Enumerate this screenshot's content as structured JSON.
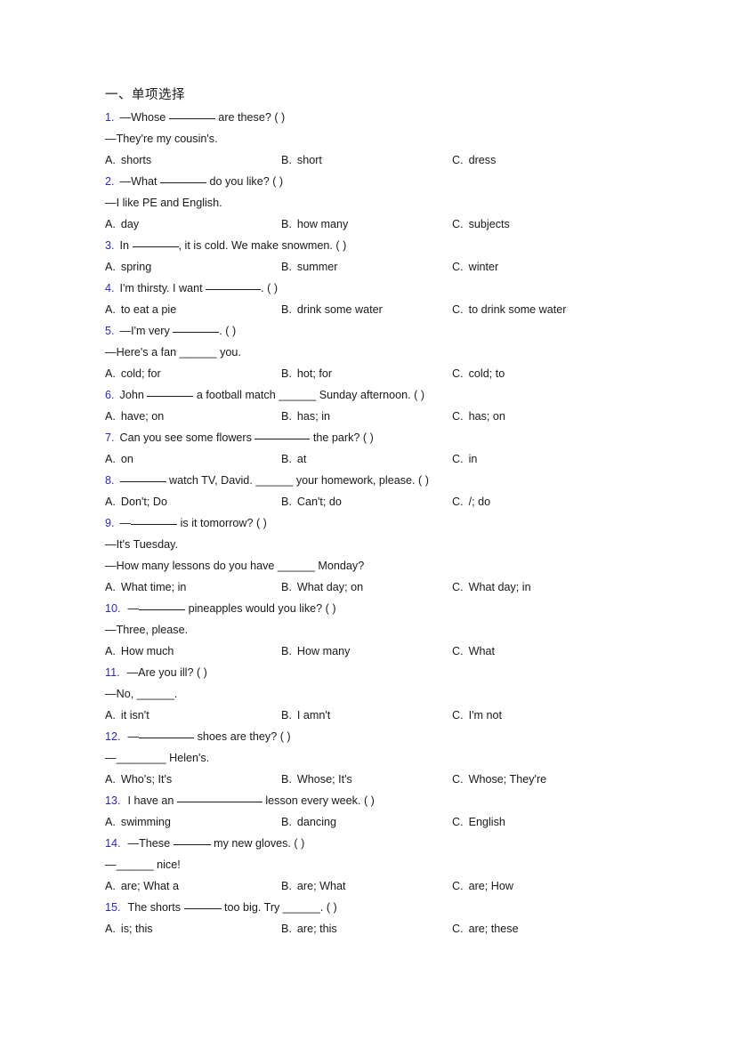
{
  "document": {
    "section_heading": "一、单项选择",
    "blank_marker": "______",
    "answer_paren": "(  )",
    "dash": "—",
    "questions": [
      {
        "number": "1.",
        "prompt_pre": "—Whose ",
        "prompt_post": " are these? (  )",
        "extra_lines": [
          "—They're my cousin's."
        ],
        "options": [
          {
            "letter": "A.",
            "text": "shorts"
          },
          {
            "letter": "B.",
            "text": "short"
          },
          {
            "letter": "C.",
            "text": "dress"
          }
        ]
      },
      {
        "number": "2.",
        "prompt_pre": "—What ",
        "prompt_post": " do you like? (  )",
        "extra_lines": [
          "—I like PE and English."
        ],
        "options": [
          {
            "letter": "A.",
            "text": "day"
          },
          {
            "letter": "B.",
            "text": "how many"
          },
          {
            "letter": "C.",
            "text": "subjects"
          }
        ]
      },
      {
        "number": "3.",
        "prompt_pre": "In ",
        "prompt_post": ", it is cold. We make snowmen. (  )",
        "extra_lines": [],
        "options": [
          {
            "letter": "A.",
            "text": "spring"
          },
          {
            "letter": "B.",
            "text": "summer"
          },
          {
            "letter": "C.",
            "text": "winter"
          }
        ]
      },
      {
        "number": "4.",
        "prompt_pre": "I'm thirsty. I want ",
        "prompt_post": ". (  )",
        "extra_lines": [],
        "options": [
          {
            "letter": "A.",
            "text": "to eat a pie"
          },
          {
            "letter": "B.",
            "text": "drink some water"
          },
          {
            "letter": "C.",
            "text": "to drink some water"
          }
        ]
      },
      {
        "number": "5.",
        "prompt_pre": "—I'm very ",
        "prompt_post": ". (  )",
        "extra_lines": [
          "—Here's a fan ______ you."
        ],
        "options": [
          {
            "letter": "A.",
            "text": "cold; for"
          },
          {
            "letter": "B.",
            "text": "hot; for"
          },
          {
            "letter": "C.",
            "text": "cold; to"
          }
        ]
      },
      {
        "number": "6.",
        "prompt_pre": "John ",
        "prompt_post": " a football match ______ Sunday afternoon. (  )",
        "extra_lines": [],
        "options": [
          {
            "letter": "A.",
            "text": "have; on"
          },
          {
            "letter": "B.",
            "text": "has; in"
          },
          {
            "letter": "C.",
            "text": "has; on"
          }
        ]
      },
      {
        "number": "7.",
        "prompt_pre": "Can you see some flowers ",
        "prompt_post": " the park? (  )",
        "extra_lines": [],
        "options": [
          {
            "letter": "A.",
            "text": "on"
          },
          {
            "letter": "B.",
            "text": "at"
          },
          {
            "letter": "C.",
            "text": "in"
          }
        ]
      },
      {
        "number": "8.",
        "prompt_pre": "",
        "prompt_post": " watch TV, David. ______ your homework, please. (  )",
        "extra_lines": [],
        "options": [
          {
            "letter": "A.",
            "text": "Don't; Do"
          },
          {
            "letter": "B.",
            "text": "Can't; do"
          },
          {
            "letter": "C.",
            "text": "/; do"
          }
        ]
      },
      {
        "number": "9.",
        "prompt_pre": "—",
        "prompt_post": " is it tomorrow? (  )",
        "extra_lines": [
          "—It's Tuesday.",
          "—How many lessons do you have ______ Monday?"
        ],
        "options": [
          {
            "letter": "A.",
            "text": "What time; in"
          },
          {
            "letter": "B.",
            "text": "What day; on"
          },
          {
            "letter": "C.",
            "text": "What day; in"
          }
        ]
      },
      {
        "number": "10.",
        "prompt_pre": "—",
        "prompt_post": " pineapples would you like? (  )",
        "extra_lines": [
          "—Three, please."
        ],
        "options": [
          {
            "letter": "A.",
            "text": "How much"
          },
          {
            "letter": "B.",
            "text": "How many"
          },
          {
            "letter": "C.",
            "text": "What"
          }
        ]
      },
      {
        "number": "11.",
        "prompt_pre": "—Are you ill? (  )",
        "prompt_post": "",
        "extra_lines": [
          "—No, ______."
        ],
        "options": [
          {
            "letter": "A.",
            "text": "it isn't"
          },
          {
            "letter": "B.",
            "text": "I amn't"
          },
          {
            "letter": "C.",
            "text": "I'm not"
          }
        ]
      },
      {
        "number": "12.",
        "prompt_pre": "—",
        "prompt_post": " shoes are they? (  )",
        "extra_lines": [
          "—________ Helen's."
        ],
        "options": [
          {
            "letter": "A.",
            "text": "Who's; It's"
          },
          {
            "letter": "B.",
            "text": "Whose; It's"
          },
          {
            "letter": "C.",
            "text": "Whose; They're"
          }
        ]
      },
      {
        "number": "13.",
        "prompt_pre": "I have an ",
        "prompt_post": " lesson every week. (  )",
        "extra_lines": [],
        "options": [
          {
            "letter": "A.",
            "text": "swimming"
          },
          {
            "letter": "B.",
            "text": "dancing"
          },
          {
            "letter": "C.",
            "text": "English"
          }
        ]
      },
      {
        "number": "14.",
        "prompt_pre": "—These ",
        "prompt_post": " my new gloves. (  )",
        "extra_lines": [
          "—______ nice!"
        ],
        "options": [
          {
            "letter": "A.",
            "text": "are; What a"
          },
          {
            "letter": "B.",
            "text": "are; What"
          },
          {
            "letter": "C.",
            "text": "are; How"
          }
        ]
      },
      {
        "number": "15.",
        "prompt_pre": "The shorts ",
        "prompt_post": " too big. Try ______. (  )",
        "extra_lines": [],
        "options": [
          {
            "letter": "A.",
            "text": "is; this"
          },
          {
            "letter": "B.",
            "text": "are; this"
          },
          {
            "letter": "C.",
            "text": "are; these"
          }
        ]
      }
    ],
    "colors": {
      "number_blue": "#2a2ab8",
      "body_text": "#1a1a1a",
      "background": "#ffffff"
    }
  }
}
